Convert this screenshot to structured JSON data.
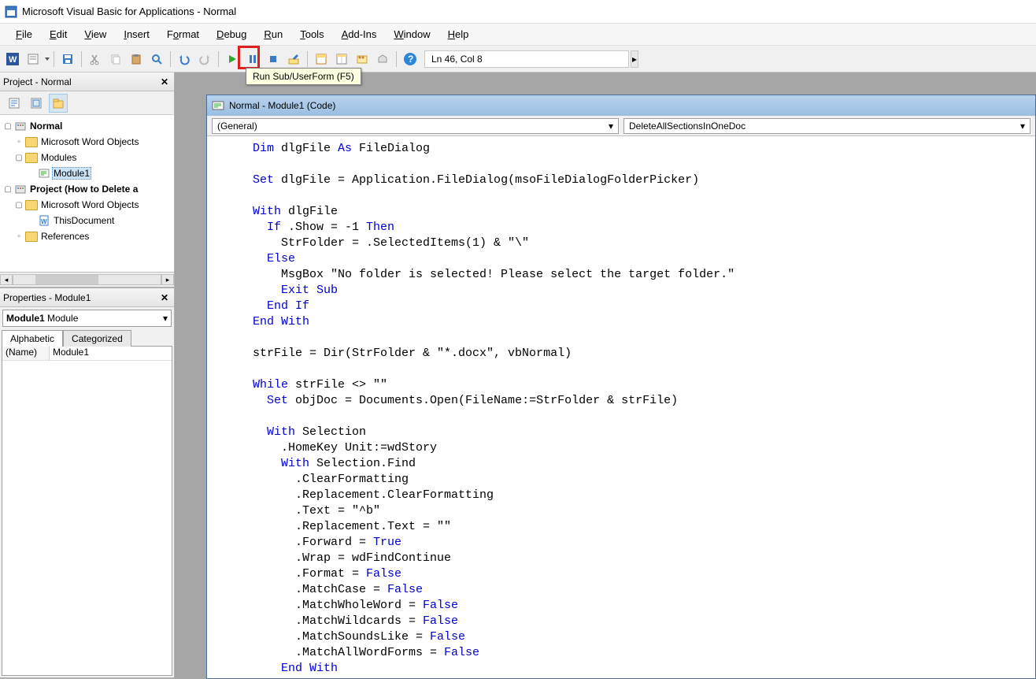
{
  "window": {
    "title": "Microsoft Visual Basic for Applications - Normal"
  },
  "menus": {
    "file": "File",
    "edit": "Edit",
    "view": "View",
    "insert": "Insert",
    "format": "Format",
    "debug": "Debug",
    "run": "Run",
    "tools": "Tools",
    "addins": "Add-Ins",
    "window": "Window",
    "help": "Help"
  },
  "toolbar": {
    "status": "Ln 46, Col 8"
  },
  "tooltip": {
    "run": "Run Sub/UserForm (F5)"
  },
  "project": {
    "title": "Project - Normal",
    "items": {
      "normal": "Normal",
      "mwo": "Microsoft Word Objects",
      "modules": "Modules",
      "module1": "Module1",
      "proj2": "Project (How to Delete a",
      "mwo2": "Microsoft Word Objects",
      "thisdoc": "ThisDocument",
      "refs": "References"
    }
  },
  "properties": {
    "title": "Properties - Module1",
    "objectName": "Module1",
    "objectType": "Module",
    "tabs": {
      "alpha": "Alphabetic",
      "cat": "Categorized"
    },
    "rows": {
      "name_label": "(Name)",
      "name_value": "Module1"
    }
  },
  "codeWindow": {
    "title": "Normal - Module1 (Code)",
    "comboLeft": "(General)",
    "comboRight": "DeleteAllSectionsInOneDoc"
  },
  "code": {
    "l1a": "  Dim",
    "l1b": " dlgFile ",
    "l1c": "As",
    "l1d": " FileDialog",
    "l2": "",
    "l3a": "  Set",
    "l3b": " dlgFile = Application.FileDialog(msoFileDialogFolderPicker)",
    "l4": "",
    "l5a": "  With",
    "l5b": " dlgFile",
    "l6a": "    If",
    "l6b": " .Show = -1 ",
    "l6c": "Then",
    "l7": "      StrFolder = .SelectedItems(1) & \"\\\"",
    "l8": "    Else",
    "l9": "      MsgBox \"No folder is selected! Please select the target folder.\"",
    "l10a": "      Exit",
    "l10b": " Sub",
    "l11": "    End If",
    "l12": "  End With",
    "l13": "",
    "l14": "  strFile = Dir(StrFolder & \"*.docx\", vbNormal)",
    "l15": "",
    "l16a": "  While",
    "l16b": " strFile <> \"\"",
    "l17a": "    Set",
    "l17b": " objDoc = Documents.Open(FileName:=StrFolder & strFile)",
    "l18": "",
    "l19a": "    With",
    "l19b": " Selection",
    "l20": "      .HomeKey Unit:=wdStory",
    "l21a": "      With",
    "l21b": " Selection.Find",
    "l22": "        .ClearFormatting",
    "l23": "        .Replacement.ClearFormatting",
    "l24": "        .Text = \"^b\"",
    "l25": "        .Replacement.Text = \"\"",
    "l26a": "        .Forward = ",
    "l26b": "True",
    "l27": "        .Wrap = wdFindContinue",
    "l28a": "        .Format = ",
    "l28b": "False",
    "l29a": "        .MatchCase = ",
    "l29b": "False",
    "l30a": "        .MatchWholeWord = ",
    "l30b": "False",
    "l31a": "        .MatchWildcards = ",
    "l31b": "False",
    "l32a": "        .MatchSoundsLike = ",
    "l32b": "False",
    "l33a": "        .MatchAllWordForms = ",
    "l33b": "False",
    "l34": "      End With"
  }
}
